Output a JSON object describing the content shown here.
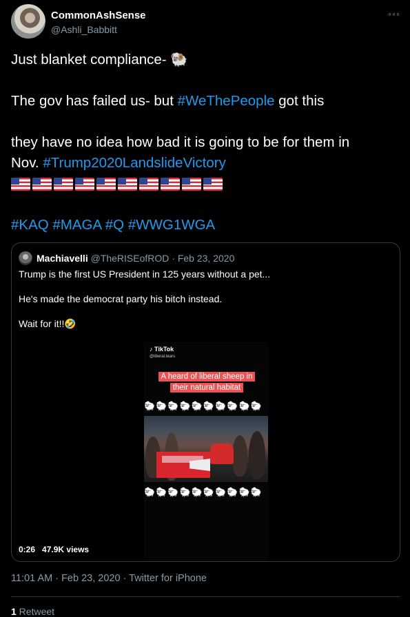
{
  "user": {
    "name": "CommonAshSense",
    "handle": "@Ashli_Babbitt"
  },
  "tweet": {
    "line1": "Just blanket compliance- 🐏",
    "line2_prefix": "The gov has failed us- but ",
    "line2_tag": "#WeThePeople",
    "line2_suffix": " got this",
    "line3": " they have no idea how bad it is going to be for them in",
    "line4_prefix": "Nov. ",
    "line4_tag": "#Trump2020LandslideVictory",
    "flag_count": 10,
    "tags": [
      "#KAQ",
      "#MAGA",
      "#Q",
      "#WWG1WGA"
    ]
  },
  "quote": {
    "name": "Machiavelli",
    "handle": "@TheRISEofROD",
    "date": "· Feb 23, 2020",
    "text1": "Trump is the first US President in 125 years without a pet...",
    "text2": "He's made the democrat party his bitch instead.",
    "text3": "Wait for it!!🤣",
    "video": {
      "brand": "♪ TikTok",
      "brand_handle": "@liberal.tears",
      "caption": "A heard of liberal sheep in their natural habitat",
      "sheep_row": "🐑🐑🐑🐑🐑🐑🐑🐑🐑🐑",
      "duration": "0:26",
      "views": "47.9K views"
    }
  },
  "meta": {
    "timestamp": "11:01 AM · Feb 23, 2020 · Twitter for iPhone",
    "retweet_count": "1",
    "retweet_label": " Retweet"
  },
  "colors": {
    "background": "#000000",
    "link": "#1d9bf0",
    "muted": "#8899a6"
  }
}
